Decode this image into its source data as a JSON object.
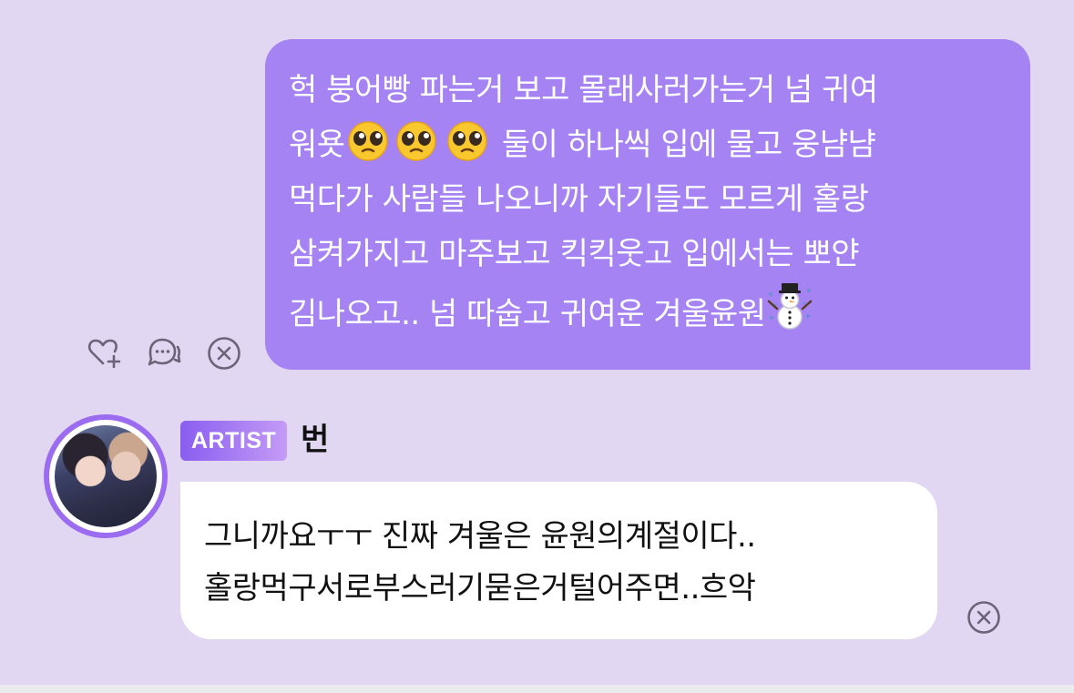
{
  "sent_message": {
    "line1": "헉 붕어빵 파는거 보고 몰래사러가는거 넘 귀여",
    "line2_prefix": "워욧",
    "line2_suffix": " 둘이 하나씩 입에 물고 웅냠냠",
    "line3": "먹다가 사람들 나오니까 자기들도 모르게 홀랑",
    "line4": "삼켜가지고 마주보고 킥킥웃고 입에서는 뽀얀",
    "line5": "김나오고.. 넘 따숩고 귀여운 겨울윤원",
    "emojis": [
      "pleading-face-emoji",
      "pleading-face-emoji",
      "pleading-face-emoji",
      "snowman-emoji"
    ]
  },
  "message_actions": [
    "like-add-icon",
    "comment-icon",
    "delete-icon"
  ],
  "reply": {
    "badge": "ARTIST",
    "author": "번",
    "line1": "그니까요ㅜㅜ 진짜 겨울은 윤원의계절이다..",
    "line2": "홀랑먹구서로부스러기묻은거털어주면..흐악",
    "action": "delete-icon"
  },
  "colors": {
    "background": "#e2d7f2",
    "sent_bubble": "#a583f3",
    "received_bubble": "#ffffff",
    "badge_gradient_start": "#8a5df0",
    "badge_gradient_end": "#c49bf6",
    "icon_gray": "#6b6478"
  }
}
